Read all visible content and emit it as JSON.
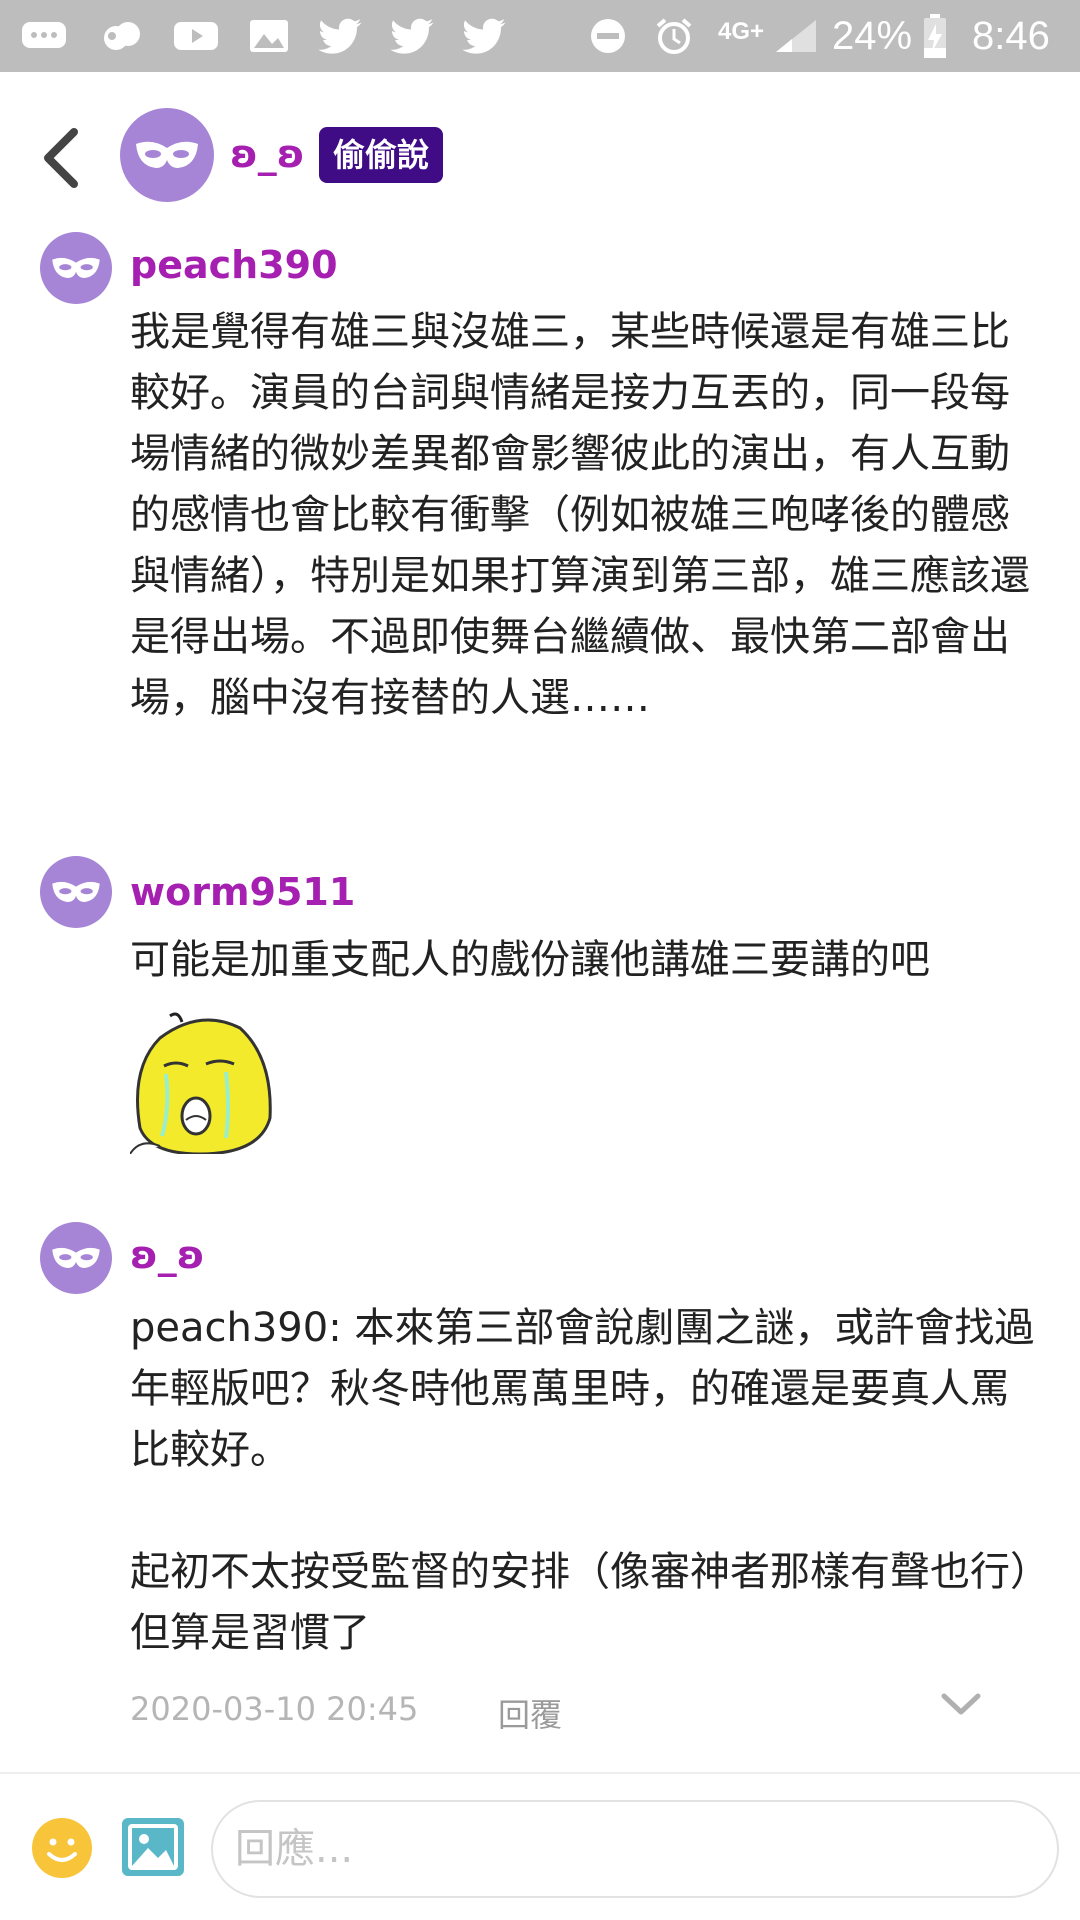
{
  "status_bar": {
    "battery": "24%",
    "time": "8:46",
    "network": "4G+",
    "icons": [
      "chat-icon",
      "cloud-icon",
      "youtube-icon",
      "gallery-icon",
      "twitter-icon",
      "twitter-icon",
      "twitter-icon",
      "do-not-disturb-icon",
      "alarm-icon",
      "signal-icon",
      "battery-icon"
    ]
  },
  "header": {
    "user_name": "ʚ_ʚ",
    "badge": "偷偷說"
  },
  "comments": [
    {
      "user": "peach390",
      "text": "我是覺得有雄三與沒雄三，某些時候還是有雄三比較好。演員的台詞與情緒是接力互丟的，同一段每場情緒的微妙差異都會影響彼此的演出，有人互動的感情也會比較有衝擊（例如被雄三咆哮後的體感與情緒），特別是如果打算演到第三部，雄三應該還是得出場。不過即使舞台繼續做、最快第二部會出場，腦中沒有接替的人選……"
    },
    {
      "user": "worm9511",
      "text": "可能是加重支配人的戲份讓他講雄三要講的吧",
      "sticker": "crying-yellow-face-sticker"
    },
    {
      "user": "ʚ_ʚ",
      "text": "peach390: 本來第三部會說劇團之謎，或許會找過年輕版吧？秋冬時他罵萬里時，的確還是要真人罵比較好。\n\n起初不太按受監督的安排（像審神者那樣有聲也行）但算是習慣了"
    }
  ],
  "meta": {
    "timestamp": "2020-03-10 20:45",
    "reply_label": "回覆"
  },
  "composer": {
    "placeholder": "回應..."
  },
  "colors": {
    "accent_purple": "#a51fb1",
    "badge_bg": "#3f0c86",
    "avatar_bg": "#a685d6",
    "status_bar_bg": "#bdbdbd"
  }
}
